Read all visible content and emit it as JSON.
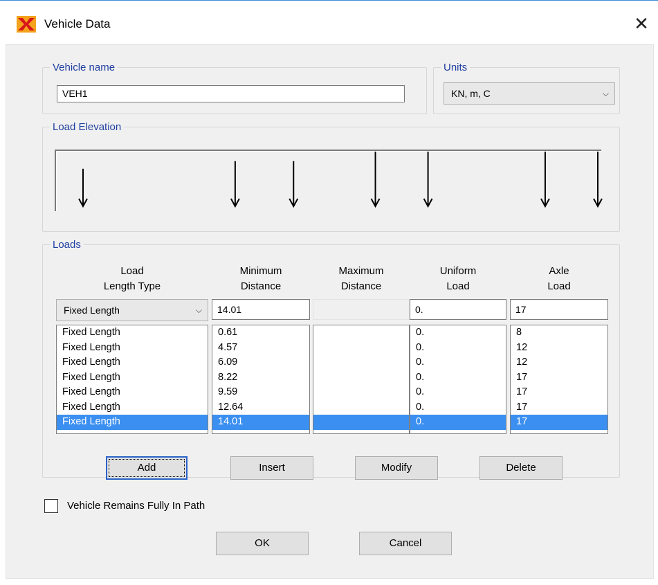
{
  "window": {
    "title": "Vehicle Data",
    "app_icon": "sap-logo-icon",
    "close_glyph": "✕"
  },
  "vehicle_name": {
    "legend": "Vehicle name",
    "value": "VEH1"
  },
  "units": {
    "legend": "Units",
    "selected": "KN, m, C"
  },
  "load_elevation": {
    "legend": "Load Elevation"
  },
  "loads": {
    "legend": "Loads",
    "headers": {
      "type": [
        "Load",
        "Length Type"
      ],
      "min": [
        "Minimum",
        "Distance"
      ],
      "max": [
        "Maximum",
        "Distance"
      ],
      "uniform": [
        "Uniform",
        "Load"
      ],
      "axle": [
        "Axle",
        "Load"
      ]
    },
    "edit": {
      "type": "Fixed Length",
      "min": "14.01",
      "max": "",
      "uniform": "0.",
      "axle": "17"
    },
    "rows": [
      {
        "type": "Fixed Length",
        "min": "0.61",
        "max": "",
        "uniform": "0.",
        "axle": "8"
      },
      {
        "type": "Fixed Length",
        "min": "4.57",
        "max": "",
        "uniform": "0.",
        "axle": "12"
      },
      {
        "type": "Fixed Length",
        "min": "6.09",
        "max": "",
        "uniform": "0.",
        "axle": "12"
      },
      {
        "type": "Fixed Length",
        "min": "8.22",
        "max": "",
        "uniform": "0.",
        "axle": "17"
      },
      {
        "type": "Fixed Length",
        "min": "9.59",
        "max": "",
        "uniform": "0.",
        "axle": "17"
      },
      {
        "type": "Fixed Length",
        "min": "12.64",
        "max": "",
        "uniform": "0.",
        "axle": "17"
      },
      {
        "type": "Fixed Length",
        "min": "14.01",
        "max": "",
        "uniform": "0.",
        "axle": "17"
      }
    ],
    "selected_row": 6,
    "buttons": {
      "add": "Add",
      "insert": "Insert",
      "modify": "Modify",
      "delete": "Delete"
    }
  },
  "remains_in_path": {
    "label": "Vehicle Remains Fully In Path",
    "checked": false
  },
  "footer": {
    "ok": "OK",
    "cancel": "Cancel"
  },
  "colors": {
    "legend": "#1e3ea0",
    "selection": "#3b8ff0",
    "focus_border": "#2a63c9"
  }
}
